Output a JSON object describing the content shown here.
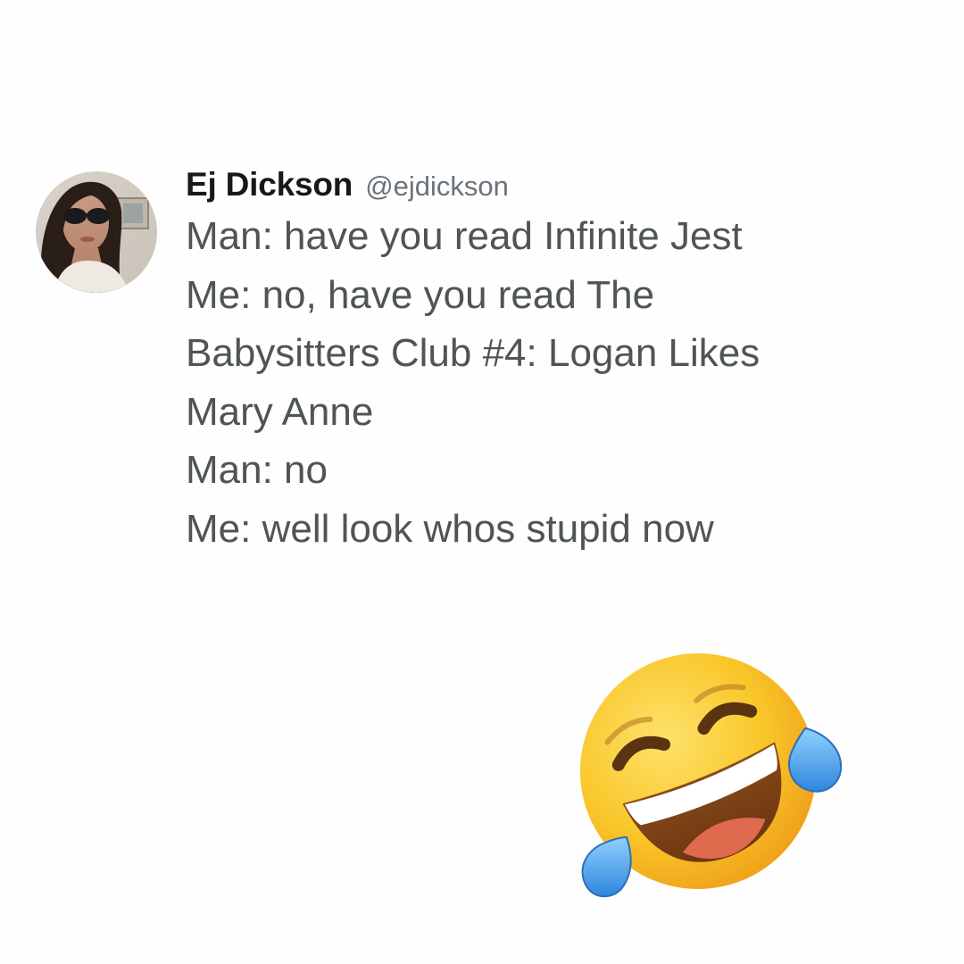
{
  "tweet": {
    "display_name": "Ej Dickson",
    "handle": "@ejdickson",
    "lines": [
      "Man: have you read Infinite Jest",
      "Me: no, have you read The",
      "Babysitters Club #4: Logan Likes",
      "Mary Anne",
      "Man: no",
      "Me: well look whos stupid now"
    ],
    "avatar_icon": "profile-photo-avatar"
  },
  "reaction": {
    "icon": "face-with-tears-of-joy-emoji"
  },
  "colors": {
    "background": "#fefefe",
    "name_text": "#15191c",
    "handle_text": "#6b737a",
    "body_text": "#4f5457",
    "emoji_face": "#f9c72a",
    "emoji_tears": "#4aa3ea"
  }
}
